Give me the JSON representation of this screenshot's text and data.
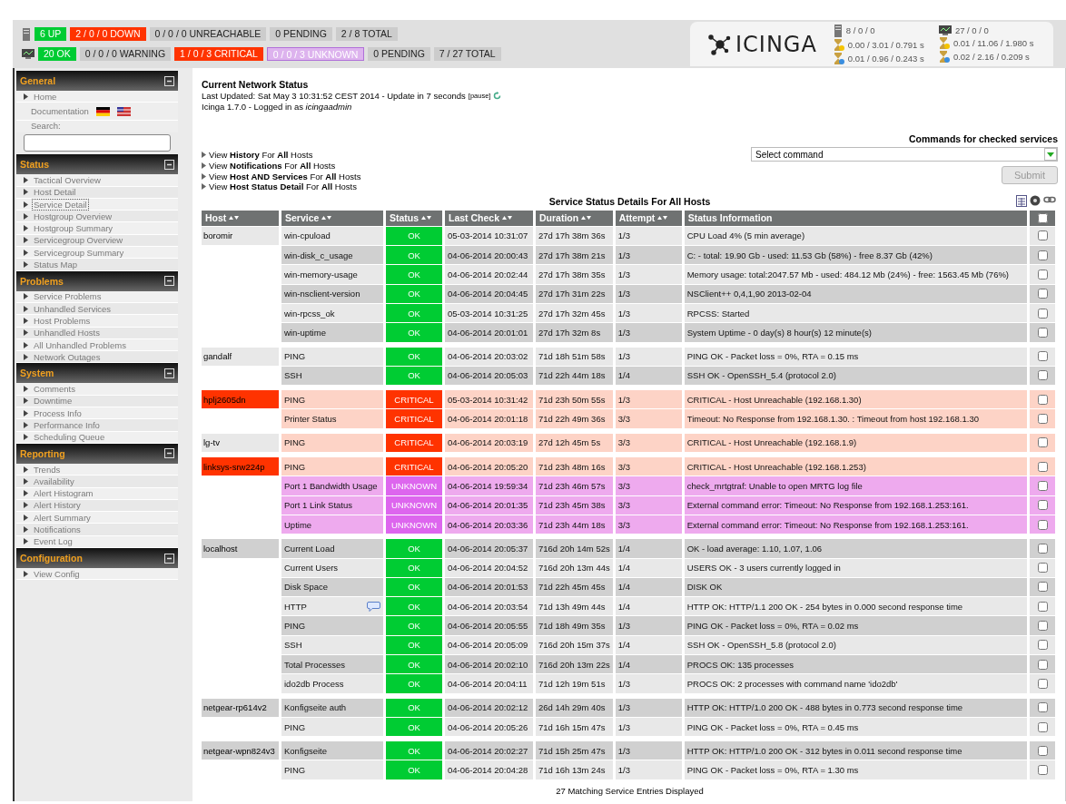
{
  "host_summary": [
    {
      "text": "6 UP",
      "kind": "up"
    },
    {
      "text": "2 / 0 / 0 DOWN",
      "kind": "down"
    },
    {
      "text": "0 / 0 / 0 UNREACHABLE",
      "kind": "neutral"
    },
    {
      "text": "0 PENDING",
      "kind": "neutral"
    },
    {
      "text": "2 / 8 TOTAL",
      "kind": "neutral"
    }
  ],
  "service_summary": [
    {
      "text": "20 OK",
      "kind": "up"
    },
    {
      "text": "0 / 0 / 0 WARNING",
      "kind": "neutral"
    },
    {
      "text": "1 / 0 / 3 CRITICAL",
      "kind": "down"
    },
    {
      "text": "0 / 0 / 3 UNKNOWN",
      "kind": "unknown"
    },
    {
      "text": "0 PENDING",
      "kind": "neutral"
    },
    {
      "text": "7 / 27 TOTAL",
      "kind": "neutral"
    }
  ],
  "logo": "ICINGA",
  "host_stats": [
    "8 / 0 / 0",
    "0.00 / 3.01 / 0.791 s",
    "0.01 / 0.96 / 0.243 s"
  ],
  "service_stats": [
    "27 / 0 / 0",
    "0.01 / 11.06 / 1.980 s",
    "0.02 / 2.16 / 0.209 s"
  ],
  "sidebar": [
    {
      "title": "General",
      "items": [
        {
          "kind": "link",
          "label": "Home",
          "selected": false
        },
        {
          "kind": "docs",
          "label": "Documentation"
        },
        {
          "kind": "search",
          "label": "Search:"
        }
      ]
    },
    {
      "title": "Status",
      "items": [
        {
          "kind": "link",
          "label": "Tactical Overview",
          "selected": false
        },
        {
          "kind": "link",
          "label": "Host Detail",
          "selected": false
        },
        {
          "kind": "link",
          "label": "Service Detail",
          "selected": true
        },
        {
          "kind": "link",
          "label": "Hostgroup Overview",
          "selected": false
        },
        {
          "kind": "link",
          "label": "Hostgroup Summary",
          "selected": false
        },
        {
          "kind": "link",
          "label": "Servicegroup Overview",
          "selected": false
        },
        {
          "kind": "link",
          "label": "Servicegroup Summary",
          "selected": false
        },
        {
          "kind": "link",
          "label": "Status Map",
          "selected": false
        }
      ]
    },
    {
      "title": "Problems",
      "items": [
        {
          "kind": "link",
          "label": "Service Problems",
          "selected": false
        },
        {
          "kind": "link",
          "label": "Unhandled Services",
          "selected": false
        },
        {
          "kind": "link",
          "label": "Host Problems",
          "selected": false
        },
        {
          "kind": "link",
          "label": "Unhandled Hosts",
          "selected": false
        },
        {
          "kind": "link",
          "label": "All Unhandled Problems",
          "selected": false
        },
        {
          "kind": "link",
          "label": "Network Outages",
          "selected": false
        }
      ]
    },
    {
      "title": "System",
      "items": [
        {
          "kind": "link",
          "label": "Comments",
          "selected": false
        },
        {
          "kind": "link",
          "label": "Downtime",
          "selected": false
        },
        {
          "kind": "link",
          "label": "Process Info",
          "selected": false
        },
        {
          "kind": "link",
          "label": "Performance Info",
          "selected": false
        },
        {
          "kind": "link",
          "label": "Scheduling Queue",
          "selected": false
        }
      ]
    },
    {
      "title": "Reporting",
      "items": [
        {
          "kind": "link",
          "label": "Trends",
          "selected": false
        },
        {
          "kind": "link",
          "label": "Availability",
          "selected": false
        },
        {
          "kind": "link",
          "label": "Alert Histogram",
          "selected": false
        },
        {
          "kind": "link",
          "label": "Alert History",
          "selected": false
        },
        {
          "kind": "link",
          "label": "Alert Summary",
          "selected": false
        },
        {
          "kind": "link",
          "label": "Notifications",
          "selected": false
        },
        {
          "kind": "link",
          "label": "Event Log",
          "selected": false
        }
      ]
    },
    {
      "title": "Configuration",
      "items": [
        {
          "kind": "link",
          "label": "View Config",
          "selected": false
        }
      ]
    }
  ],
  "page": {
    "title": "Current Network Status",
    "updated": "Last Updated: Sat May 3 10:31:52 CEST 2014 - Update in 7 seconds",
    "pause": "[pause]",
    "login": "Icinga 1.7.0 - Logged in as *icingaadmin*"
  },
  "view_links": [
    "View **History** For **All** Hosts",
    "View **Notifications** For **All** Hosts",
    "View **Host AND Services** For **All** Hosts",
    "View **Host Status Detail** For **All** Hosts"
  ],
  "commands": {
    "title": "Commands for checked services",
    "select": "Select command",
    "submit": "Submit",
    "submit_disabled": true
  },
  "table": {
    "title": "Service Status Details For All Hosts",
    "columns": [
      "Host",
      "Service",
      "Status",
      "Last Check",
      "Duration",
      "Attempt",
      "Status Information"
    ],
    "all_checked": false,
    "hosts": [
      {
        "name": "boromir",
        "down": false,
        "services": [
          {
            "name": "win-cpuload",
            "kind": "ok",
            "status": "OK",
            "last_check": "05-03-2014 10:31:07",
            "duration": "27d 17h 38m 36s",
            "attempt": "1/3",
            "info": "CPU Load 4% (5 min average)",
            "checked": false,
            "comment": false
          },
          {
            "name": "win-disk_c_usage",
            "kind": "ok",
            "status": "OK",
            "last_check": "04-06-2014 20:00:43",
            "duration": "27d 17h 38m 21s",
            "attempt": "1/3",
            "info": "C: - total: 19.90 Gb - used: 11.53 Gb (58%) - free 8.37 Gb (42%)",
            "checked": false,
            "comment": false
          },
          {
            "name": "win-memory-usage",
            "kind": "ok",
            "status": "OK",
            "last_check": "04-06-2014 20:02:44",
            "duration": "27d 17h 38m 35s",
            "attempt": "1/3",
            "info": "Memory usage: total:2047.57 Mb - used: 484.12 Mb (24%) - free: 1563.45 Mb (76%)",
            "checked": false,
            "comment": false
          },
          {
            "name": "win-nsclient-version",
            "kind": "ok",
            "status": "OK",
            "last_check": "04-06-2014 20:04:45",
            "duration": "27d 17h 31m 22s",
            "attempt": "1/3",
            "info": "NSClient++ 0,4,1,90 2013-02-04",
            "checked": false,
            "comment": false
          },
          {
            "name": "win-rpcss_ok",
            "kind": "ok",
            "status": "OK",
            "last_check": "05-03-2014 10:31:25",
            "duration": "27d 17h 32m 45s",
            "attempt": "1/3",
            "info": "RPCSS: Started",
            "checked": false,
            "comment": false
          },
          {
            "name": "win-uptime",
            "kind": "ok",
            "status": "OK",
            "last_check": "04-06-2014 20:01:01",
            "duration": "27d 17h 32m 8s",
            "attempt": "1/3",
            "info": "System Uptime - 0 day(s) 8 hour(s) 12 minute(s)",
            "checked": false,
            "comment": false
          }
        ]
      },
      {
        "name": "gandalf",
        "down": false,
        "services": [
          {
            "name": "PING",
            "kind": "ok",
            "status": "OK",
            "last_check": "04-06-2014 20:03:02",
            "duration": "71d 18h 51m 58s",
            "attempt": "1/3",
            "info": "PING OK - Packet loss = 0%, RTA = 0.15 ms",
            "checked": false,
            "comment": false
          },
          {
            "name": "SSH",
            "kind": "ok",
            "status": "OK",
            "last_check": "04-06-2014 20:05:03",
            "duration": "71d 22h 44m 18s",
            "attempt": "1/4",
            "info": "SSH OK - OpenSSH_5.4 (protocol 2.0)",
            "checked": false,
            "comment": false
          }
        ]
      },
      {
        "name": "hplj2605dn",
        "down": true,
        "services": [
          {
            "name": "PING",
            "kind": "critical",
            "status": "CRITICAL",
            "last_check": "05-03-2014 10:31:42",
            "duration": "71d 23h 50m 55s",
            "attempt": "1/3",
            "info": "CRITICAL - Host Unreachable (192.168.1.30)",
            "checked": false,
            "comment": false
          },
          {
            "name": "Printer Status",
            "kind": "critical",
            "status": "CRITICAL",
            "last_check": "04-06-2014 20:01:18",
            "duration": "71d 22h 49m 36s",
            "attempt": "3/3",
            "info": "Timeout: No Response from 192.168.1.30. : Timeout from host 192.168.1.30",
            "checked": false,
            "comment": false
          }
        ]
      },
      {
        "name": "lg-tv",
        "down": false,
        "services": [
          {
            "name": "PING",
            "kind": "critical",
            "status": "CRITICAL",
            "last_check": "04-06-2014 20:03:19",
            "duration": "27d 12h 45m 5s",
            "attempt": "3/3",
            "info": "CRITICAL - Host Unreachable (192.168.1.9)",
            "checked": false,
            "comment": false
          }
        ]
      },
      {
        "name": "linksys-srw224p",
        "down": true,
        "services": [
          {
            "name": "PING",
            "kind": "critical",
            "status": "CRITICAL",
            "last_check": "04-06-2014 20:05:20",
            "duration": "71d 23h 48m 16s",
            "attempt": "3/3",
            "info": "CRITICAL - Host Unreachable (192.168.1.253)",
            "checked": false,
            "comment": false
          },
          {
            "name": "Port 1 Bandwidth Usage",
            "kind": "unknown",
            "status": "UNKNOWN",
            "last_check": "04-06-2014 19:59:34",
            "duration": "71d 23h 46m 57s",
            "attempt": "3/3",
            "info": "check_mrtgtraf: Unable to open MRTG log file",
            "checked": false,
            "comment": false
          },
          {
            "name": "Port 1 Link Status",
            "kind": "unknown",
            "status": "UNKNOWN",
            "last_check": "04-06-2014 20:01:35",
            "duration": "71d 23h 45m 38s",
            "attempt": "3/3",
            "info": "External command error: Timeout: No Response from 192.168.1.253:161.",
            "checked": false,
            "comment": false
          },
          {
            "name": "Uptime",
            "kind": "unknown",
            "status": "UNKNOWN",
            "last_check": "04-06-2014 20:03:36",
            "duration": "71d 23h 44m 18s",
            "attempt": "3/3",
            "info": "External command error: Timeout: No Response from 192.168.1.253:161.",
            "checked": false,
            "comment": false
          }
        ]
      },
      {
        "name": "localhost",
        "down": false,
        "services": [
          {
            "name": "Current Load",
            "kind": "ok",
            "status": "OK",
            "last_check": "04-06-2014 20:05:37",
            "duration": "716d 20h 14m 52s",
            "attempt": "1/4",
            "info": "OK - load average: 1.10, 1.07, 1.06",
            "checked": false,
            "comment": false
          },
          {
            "name": "Current Users",
            "kind": "ok",
            "status": "OK",
            "last_check": "04-06-2014 20:04:52",
            "duration": "716d 20h 13m 44s",
            "attempt": "1/4",
            "info": "USERS OK - 3 users currently logged in",
            "checked": false,
            "comment": false
          },
          {
            "name": "Disk Space",
            "kind": "ok",
            "status": "OK",
            "last_check": "04-06-2014 20:01:53",
            "duration": "71d 22h 45m 45s",
            "attempt": "1/4",
            "info": "DISK OK",
            "checked": false,
            "comment": false
          },
          {
            "name": "HTTP",
            "kind": "ok",
            "status": "OK",
            "last_check": "04-06-2014 20:03:54",
            "duration": "71d 13h 49m 44s",
            "attempt": "1/4",
            "info": "HTTP OK: HTTP/1.1 200 OK - 254 bytes in 0.000 second response time",
            "checked": false,
            "comment": true
          },
          {
            "name": "PING",
            "kind": "ok",
            "status": "OK",
            "last_check": "04-06-2014 20:05:55",
            "duration": "71d 18h 49m 35s",
            "attempt": "1/3",
            "info": "PING OK - Packet loss = 0%, RTA = 0.02 ms",
            "checked": false,
            "comment": false
          },
          {
            "name": "SSH",
            "kind": "ok",
            "status": "OK",
            "last_check": "04-06-2014 20:05:09",
            "duration": "716d 20h 15m 37s",
            "attempt": "1/4",
            "info": "SSH OK - OpenSSH_5.8 (protocol 2.0)",
            "checked": false,
            "comment": false
          },
          {
            "name": "Total Processes",
            "kind": "ok",
            "status": "OK",
            "last_check": "04-06-2014 20:02:10",
            "duration": "716d 20h 13m 22s",
            "attempt": "1/4",
            "info": "PROCS OK: 135 processes",
            "checked": false,
            "comment": false
          },
          {
            "name": "ido2db Process",
            "kind": "ok",
            "status": "OK",
            "last_check": "04-06-2014 20:04:11",
            "duration": "71d 12h 19m 51s",
            "attempt": "1/3",
            "info": "PROCS OK: 2 processes with command name 'ido2db'",
            "checked": false,
            "comment": false
          }
        ]
      },
      {
        "name": "netgear-rp614v2",
        "down": false,
        "services": [
          {
            "name": "Konfigseite auth",
            "kind": "ok",
            "status": "OK",
            "last_check": "04-06-2014 20:02:12",
            "duration": "26d 14h 29m 40s",
            "attempt": "1/3",
            "info": "HTTP OK: HTTP/1.0 200 OK - 488 bytes in 0.773 second response time",
            "checked": false,
            "comment": false
          },
          {
            "name": "PING",
            "kind": "ok",
            "status": "OK",
            "last_check": "04-06-2014 20:05:26",
            "duration": "71d 16h 15m 47s",
            "attempt": "1/3",
            "info": "PING OK - Packet loss = 0%, RTA = 0.45 ms",
            "checked": false,
            "comment": false
          }
        ]
      },
      {
        "name": "netgear-wpn824v3",
        "down": false,
        "services": [
          {
            "name": "Konfigseite",
            "kind": "ok",
            "status": "OK",
            "last_check": "04-06-2014 20:02:27",
            "duration": "71d 15h 25m 47s",
            "attempt": "1/3",
            "info": "HTTP OK: HTTP/1.0 200 OK - 312 bytes in 0.011 second response time",
            "checked": false,
            "comment": false
          },
          {
            "name": "PING",
            "kind": "ok",
            "status": "OK",
            "last_check": "04-06-2014 20:04:28",
            "duration": "71d 16h 13m 24s",
            "attempt": "1/3",
            "info": "PING OK - Packet loss = 0%, RTA = 1.30 ms",
            "checked": false,
            "comment": false
          }
        ]
      }
    ],
    "footer": "27 Matching Service Entries Displayed"
  }
}
